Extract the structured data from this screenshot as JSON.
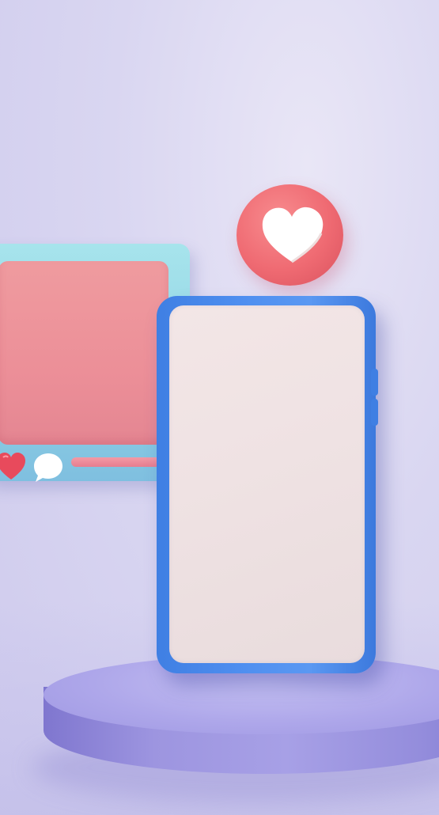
{
  "scene": {
    "background_color": "#d9d6f1",
    "pedestal_color": "#a7a0e6",
    "post_card": {
      "frame_color": "#a7e4ec",
      "image_color": "#ec8f98",
      "icons": [
        "heart-icon",
        "speech-bubble-icon"
      ]
    },
    "heart_badge": {
      "color": "#ef6a72",
      "icon": "heart-icon"
    },
    "phone": {
      "frame_color": "#4f8ff0",
      "screen_color": "#efe2e3"
    }
  }
}
